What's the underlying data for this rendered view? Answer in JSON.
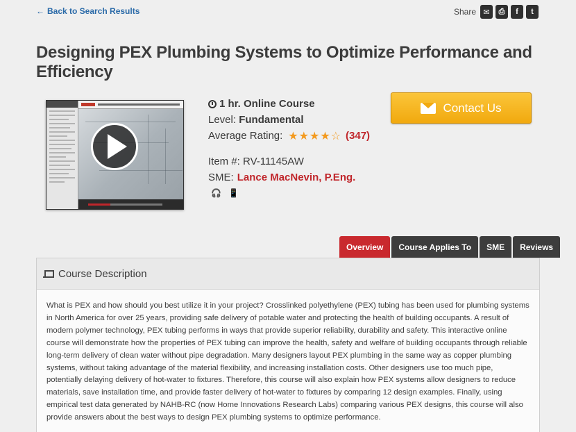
{
  "nav": {
    "back_arrow": "←",
    "back_label": "Back to Search Results"
  },
  "share": {
    "label": "Share",
    "buttons": [
      {
        "icon": "email-icon",
        "glyph": "✉"
      },
      {
        "icon": "print-icon",
        "glyph": "⎙"
      },
      {
        "icon": "facebook-icon",
        "glyph": "f"
      },
      {
        "icon": "twitter-icon",
        "glyph": "t"
      }
    ]
  },
  "course": {
    "title": "Designing PEX Plumbing Systems to Optimize Performance and Efficiency",
    "duration": "1 hr. Online Course",
    "level_label": "Level:",
    "level_value": "Fundamental",
    "rating_label": "Average Rating:",
    "rating_stars": 4,
    "rating_max": 5,
    "rating_count": "(347)",
    "item_label": "Item #:",
    "item_value": "RV-11145AW",
    "sme_label": "SME:",
    "sme_name": "Lance MacNevin, P.Eng.",
    "format_icons": [
      "headphones-icon",
      "mobile-icon"
    ]
  },
  "video": {
    "progress": 0.3
  },
  "contact": {
    "label": "Contact Us",
    "icon": "envelope-icon"
  },
  "tabs": [
    {
      "label": "Overview",
      "active": true
    },
    {
      "label": "Course Applies To",
      "active": false
    },
    {
      "label": "SME",
      "active": false
    },
    {
      "label": "Reviews",
      "active": false
    }
  ],
  "description": {
    "heading": "Course Description",
    "icon": "laptop-icon",
    "body": "What is PEX and how should you best utilize it in your project? Crosslinked polyethylene (PEX) tubing has been used for plumbing systems in North America for over 25 years, providing safe delivery of potable water and protecting the health of building occupants. A result of modern polymer technology, PEX tubing performs in ways that provide superior reliability, durability and safety. This interactive online course will demonstrate how the properties of PEX tubing can improve the health, safety and welfare of building occupants through reliable long-term delivery of clean water without pipe degradation. Many designers layout PEX plumbing in the same way as copper plumbing systems, without taking advantage of the material flexibility, and increasing installation costs. Other designers use too much pipe, potentially delaying delivery of hot-water to fixtures. Therefore, this course will also explain how PEX systems allow designers to reduce materials, save installation time, and provide faster delivery of hot-water to fixtures by comparing 12 design examples. Finally, using empirical test data generated by NAHB-RC (now Home Innovations Research Labs) comparing various PEX designs, this course will also provide answers about the best ways to design PEX plumbing systems to optimize performance."
  }
}
